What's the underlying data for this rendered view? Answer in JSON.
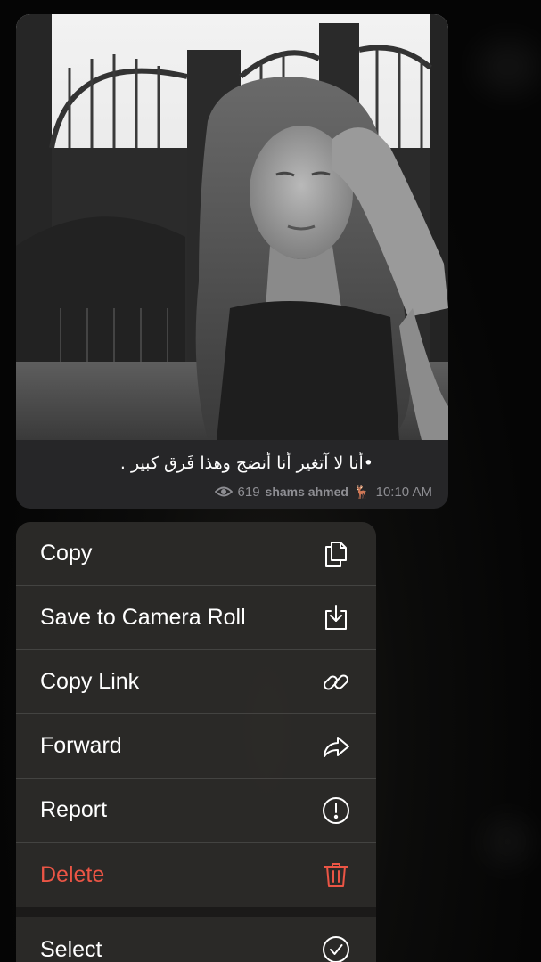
{
  "message": {
    "caption": "•أنا لا آتغير أنا أنضج وهذا فَرق كبير .",
    "views": "619",
    "author": "shams ahmed",
    "author_emoji": "🦌",
    "time": "10:10 AM"
  },
  "menu": {
    "items": [
      {
        "label": "Copy",
        "icon": "copy-icon"
      },
      {
        "label": "Save to Camera Roll",
        "icon": "download-icon"
      },
      {
        "label": "Copy Link",
        "icon": "link-icon"
      },
      {
        "label": "Forward",
        "icon": "forward-arrow-icon"
      },
      {
        "label": "Report",
        "icon": "exclamation-circle-icon"
      },
      {
        "label": "Delete",
        "icon": "trash-icon"
      },
      {
        "label": "Select",
        "icon": "checkmark-circle-icon"
      }
    ]
  },
  "colors": {
    "danger": "#eb5545",
    "menu_background": "#2c2b29",
    "bubble_background": "#262628",
    "meta_text": "#8e8e93"
  }
}
